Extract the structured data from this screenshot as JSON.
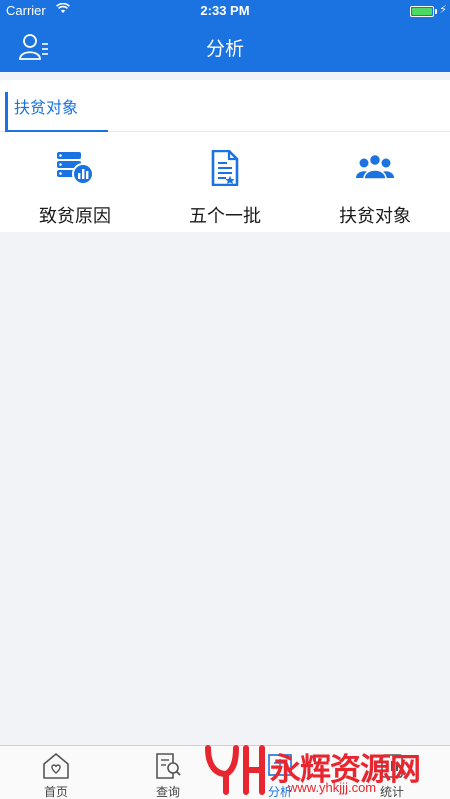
{
  "status_bar": {
    "carrier": "Carrier",
    "time": "2:33 PM"
  },
  "nav": {
    "title": "分析",
    "left_icon": "user-list-icon"
  },
  "section": {
    "tab_label": "扶贫对象",
    "items": [
      {
        "label": "致贫原因",
        "icon": "database-chart-icon"
      },
      {
        "label": "五个一批",
        "icon": "document-icon"
      },
      {
        "label": "扶贫对象",
        "icon": "group-icon"
      }
    ]
  },
  "tab_bar": {
    "items": [
      {
        "label": "首页",
        "icon": "home-heart-icon"
      },
      {
        "label": "查询",
        "icon": "search-doc-icon"
      },
      {
        "label": "分析",
        "icon": "analysis-icon",
        "active": true
      },
      {
        "label": "统计",
        "icon": "statistics-icon"
      }
    ]
  },
  "watermark": {
    "brand": "永辉资源网",
    "url": "www.yhkjjj.com"
  },
  "colors": {
    "primary": "#1a73e0",
    "background": "#f2f3f6",
    "watermark": "#e8262f"
  }
}
